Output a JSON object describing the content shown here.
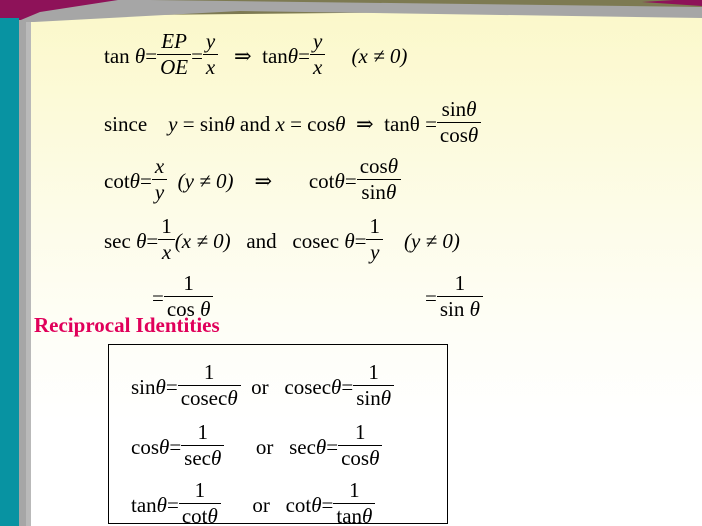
{
  "slide": {
    "background_top_color": "#fbf8c8",
    "background_bottom_color": "#ffffff",
    "accent_teal": "#0893a2",
    "accent_purple": "#8e1259",
    "accent_gray": "#a6a6a6",
    "heading_color": "#e0005a"
  },
  "heading": {
    "text": "Reciprocal Identities"
  },
  "derivation": {
    "line1": {
      "lhs_func": "tan",
      "lhs_theta": "θ",
      "eq1": "=",
      "frac1_num": "EP",
      "frac1_den": "OE",
      "eq2": "=",
      "frac2_num": "y",
      "frac2_den": "x",
      "implies": "⇒",
      "rhs_func": "tan",
      "rhs_theta": "θ",
      "eq3": "=",
      "frac3_num": "y",
      "frac3_den": "x",
      "condition": "(x ≠ 0)"
    },
    "line2": {
      "since": "since",
      "y_var": "y",
      "eq1": "=",
      "sin": "sin",
      "theta1": "θ",
      "and": "and",
      "x_var": "x",
      "eq2": "=",
      "cos": "cos",
      "theta2": "θ",
      "implies": "⇒",
      "rhs_func": "tan",
      "rhs_theta": "θ",
      "eq3": "=",
      "frac_num_func": "sin",
      "frac_num_theta": "θ",
      "frac_den_func": "cos",
      "frac_den_theta": "θ"
    },
    "line3": {
      "lhs_func": "cot",
      "lhs_theta": "θ",
      "eq1": "=",
      "frac1_num": "x",
      "frac1_den": "y",
      "condition": "(y ≠ 0)",
      "implies": "⇒",
      "rhs_func": "cot",
      "rhs_theta": "θ",
      "eq2": "=",
      "frac2_num_func": "cos",
      "frac2_num_theta": "θ",
      "frac2_den_func": "sin",
      "frac2_den_theta": "θ"
    },
    "line4": {
      "lhs_func": "sec",
      "lhs_theta": "θ",
      "eq1": "=",
      "frac1_num": "1",
      "frac1_den": "x",
      "condition1": "(x ≠ 0)",
      "and": "and",
      "rhs_func": "cosec",
      "rhs_theta": "θ",
      "eq2": "=",
      "frac2_num": "1",
      "frac2_den": "y",
      "condition2": "(y ≠ 0)"
    },
    "line5": {
      "left_eq": "=",
      "left_num": "1",
      "left_den_func": "cos",
      "left_den_theta": "θ",
      "right_eq": "=",
      "right_num": "1",
      "right_den_func": "sin",
      "right_den_theta": "θ"
    }
  },
  "identity_box": {
    "rows": [
      {
        "left_func": "sin",
        "left_theta": "θ",
        "left_eq": "=",
        "left_num": "1",
        "left_den_func": "cosec",
        "left_den_theta": "θ",
        "conjunction": "or",
        "right_func": "cosec",
        "right_theta": "θ",
        "right_eq": "=",
        "right_num": "1",
        "right_den_func": "sin",
        "right_den_theta": "θ"
      },
      {
        "left_func": "cos",
        "left_theta": "θ",
        "left_eq": "=",
        "left_num": "1",
        "left_den_func": "sec",
        "left_den_theta": "θ",
        "conjunction": "or",
        "right_func": "sec",
        "right_theta": "θ",
        "right_eq": "=",
        "right_num": "1",
        "right_den_func": "cos",
        "right_den_theta": "θ"
      },
      {
        "left_func": "tan",
        "left_theta": "θ",
        "left_eq": "=",
        "left_num": "1",
        "left_den_func": "cot",
        "left_den_theta": "θ",
        "conjunction": "or",
        "right_func": "cot",
        "right_theta": "θ",
        "right_eq": "=",
        "right_num": "1",
        "right_den_func": "tan",
        "right_den_theta": "θ"
      }
    ]
  }
}
